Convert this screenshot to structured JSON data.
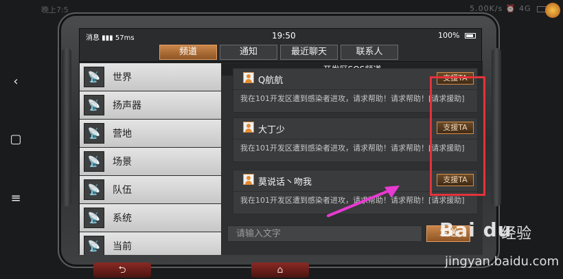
{
  "system_bar": {
    "left_text": "晚上7:5",
    "right_text": "5.00K/s ⏰ 4G",
    "battery_label": ""
  },
  "nav": {
    "back": "‹",
    "home": "▢",
    "menu": "≡"
  },
  "phone_status": {
    "left": "消息 ▮▮▮ 57ms",
    "time": "19:50",
    "battery": "100%"
  },
  "tabs": [
    {
      "label": "频道",
      "active": true
    },
    {
      "label": "通知",
      "active": false
    },
    {
      "label": "最近聊天",
      "active": false
    },
    {
      "label": "联系人",
      "active": false
    }
  ],
  "sidebar": {
    "items": [
      {
        "label": "世界",
        "icon": "satellite-dish-icon"
      },
      {
        "label": "扬声器",
        "icon": "satellite-dish-icon"
      },
      {
        "label": "营地",
        "icon": "satellite-dish-icon"
      },
      {
        "label": "场景",
        "icon": "satellite-dish-icon"
      },
      {
        "label": "队伍",
        "icon": "satellite-dish-icon"
      },
      {
        "label": "系统",
        "icon": "satellite-dish-icon"
      },
      {
        "label": "当前",
        "icon": "satellite-dish-icon"
      }
    ]
  },
  "channel": {
    "title": "开发区SOS频道",
    "messages": [
      {
        "name": "Q航航",
        "text": "我在101开发区遭到感染者进攻，请求帮助！请求帮助！[请求援助]",
        "button": "支援TA"
      },
      {
        "name": "大丁少",
        "text": "我在101开发区遭到感染者进攻，请求帮助！请求帮助！[请求援助]",
        "button": "支援TA"
      },
      {
        "name": "莫说话丶吻我",
        "text": "我在101开发区遭到感染者进攻，请求帮助！请求帮助！[请求援助]",
        "button": "支援TA"
      }
    ]
  },
  "input": {
    "placeholder": "请输入文字",
    "send_label": "发送"
  },
  "bottom": {
    "back_icon": "⮌",
    "home_icon": "⌂"
  },
  "watermark": {
    "logo": "Bai du",
    "sub": "经验",
    "url": "jingyan.baidu.com"
  },
  "colors": {
    "accent": "#c9864a",
    "highlight": "#e5323b",
    "arrow": "#e83ad2"
  }
}
